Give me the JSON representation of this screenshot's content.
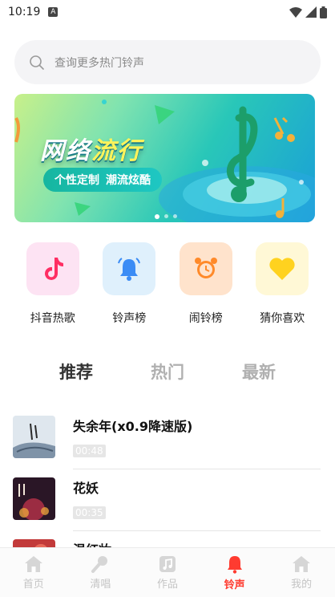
{
  "status": {
    "time": "10:19",
    "sim": "A"
  },
  "search": {
    "placeholder": "查询更多热门铃声"
  },
  "banner": {
    "title_a": "网络",
    "title_b": "流行",
    "pill_a": "个性定制",
    "pill_b": "潮流炫酷"
  },
  "quick": [
    {
      "label": "抖音热歌",
      "icon": "tiktok-icon"
    },
    {
      "label": "铃声榜",
      "icon": "bell-icon"
    },
    {
      "label": "闹铃榜",
      "icon": "alarm-clock-icon"
    },
    {
      "label": "猜你喜欢",
      "icon": "heart-icon"
    }
  ],
  "tabs": [
    "推荐",
    "热门",
    "最新"
  ],
  "songs": [
    {
      "name": "失余年(x0.9降速版)",
      "duration": "00:48"
    },
    {
      "name": "花妖",
      "duration": "00:35"
    },
    {
      "name": "温红妆",
      "duration": ""
    }
  ],
  "tabbar": [
    {
      "label": "首页",
      "icon": "home-icon"
    },
    {
      "label": "清唱",
      "icon": "microphone-icon"
    },
    {
      "label": "作品",
      "icon": "music-note-icon"
    },
    {
      "label": "铃声",
      "icon": "bell-icon"
    },
    {
      "label": "我的",
      "icon": "profile-icon"
    }
  ],
  "colors": {
    "accent": "#ff3b30",
    "inactive": "#c4c4c4"
  }
}
